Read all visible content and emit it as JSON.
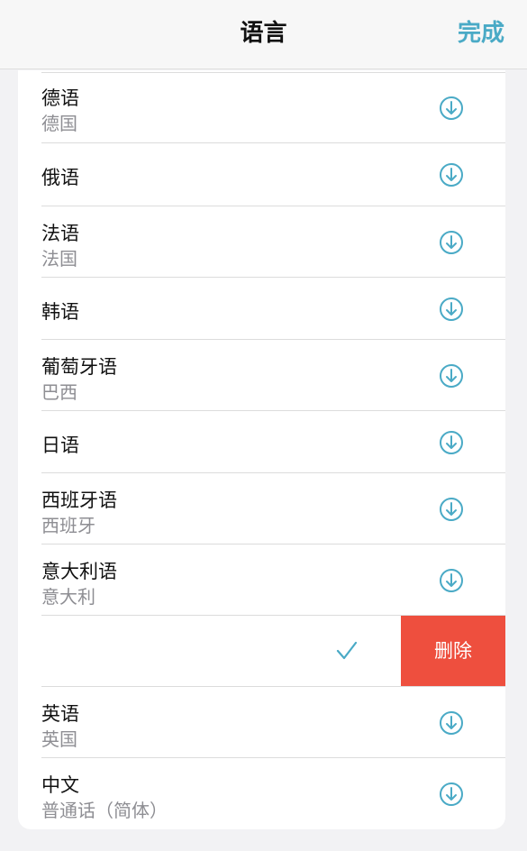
{
  "header": {
    "title": "语言",
    "done_label": "完成"
  },
  "languages": [
    {
      "name": "德语",
      "region": "德国",
      "icon": "download-icon"
    },
    {
      "name": "俄语",
      "region": "",
      "icon": "download-icon"
    },
    {
      "name": "法语",
      "region": "法国",
      "icon": "download-icon"
    },
    {
      "name": "韩语",
      "region": "",
      "icon": "download-icon"
    },
    {
      "name": "葡萄牙语",
      "region": "巴西",
      "icon": "download-icon"
    },
    {
      "name": "日语",
      "region": "",
      "icon": "download-icon"
    },
    {
      "name": "西班牙语",
      "region": "西班牙",
      "icon": "download-icon"
    },
    {
      "name": "意大利语",
      "region": "意大利",
      "icon": "download-icon"
    }
  ],
  "swiped_row": {
    "state_icon": "checkmark-icon",
    "delete_label": "删除"
  },
  "languages_bottom": [
    {
      "name": "英语",
      "region": "英国",
      "icon": "download-icon"
    },
    {
      "name": "中文",
      "region": "普通话（简体）",
      "icon": "download-icon"
    }
  ],
  "colors": {
    "accent": "#4aaac6",
    "delete": "#ee4f3e",
    "secondary_text": "#8e8e93"
  }
}
